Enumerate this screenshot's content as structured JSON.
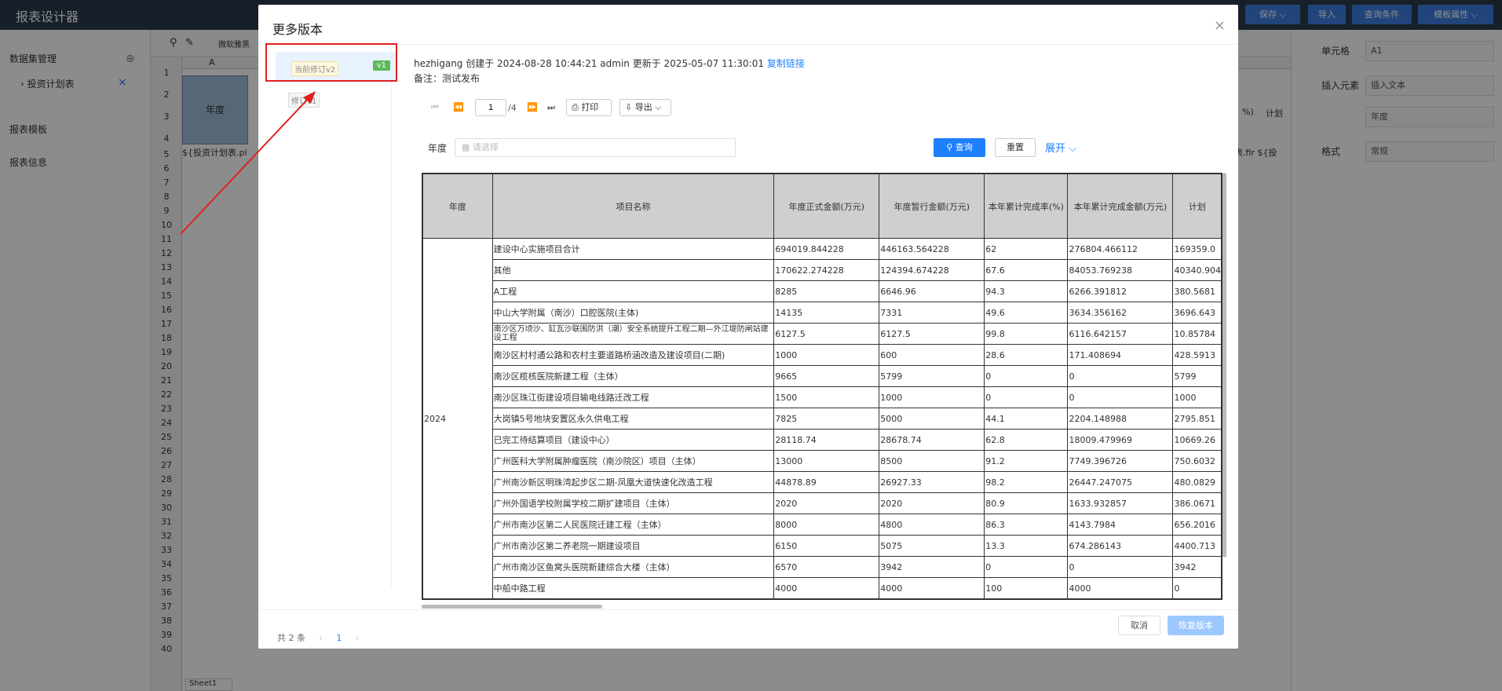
{
  "app": {
    "title": "报表设计器",
    "toolbar_buttons": [
      "保存 ⌵",
      "导入",
      "查询条件",
      "模板属性 ⌵"
    ],
    "left_items": [
      "数据集管理",
      "投资计划表",
      "报表模板",
      "报表信息"
    ],
    "sheet_toolbar_font": "微软雅黑",
    "col_a": "A",
    "cell_year": "年度",
    "cell_formula": "${投资计划表.pl",
    "cell_formula_right": "表.fir ${投",
    "cell_pct": "%)",
    "cell_plan": "计划",
    "row_numbers": [
      "1",
      "2",
      "3",
      "4",
      "5",
      "6",
      "7",
      "8",
      "9",
      "10",
      "11",
      "12",
      "13",
      "14",
      "15",
      "16",
      "17",
      "18",
      "19",
      "20",
      "21",
      "22",
      "23",
      "24",
      "25",
      "26",
      "27",
      "28",
      "29",
      "30",
      "31",
      "32",
      "33",
      "34",
      "35",
      "36",
      "37",
      "38",
      "39",
      "40"
    ],
    "sheet_tab": "Sheet1",
    "right_panel": {
      "cell_label": "单元格",
      "cell_value": "A1",
      "insert_label": "插入元素",
      "insert_value": "插入文本",
      "text_value": "年度",
      "format_label": "格式",
      "format_value": "常规"
    }
  },
  "dialog": {
    "title": "更多版本",
    "close": "×",
    "versions": [
      {
        "label": "当前修订v2",
        "badge": "v1"
      },
      {
        "label": "修订v1"
      }
    ],
    "pager": {
      "total": "共 2 条",
      "prev": "‹",
      "page": "1",
      "next": "›"
    },
    "info_line1_text": "hezhigang 创建于 2024-08-28 10:44:21 admin 更新于 2025-05-07 11:30:01",
    "info_link": "复制链接",
    "info_line2": "备注：测试发布",
    "page_input": "1",
    "page_total": "/4",
    "print": "打印",
    "export": "导出",
    "filter_label": "年度",
    "filter_placeholder": "请选择",
    "query_btn": "查询",
    "reset_btn": "重置",
    "expand": "展开",
    "cancel": "取消",
    "restore": "恢复版本"
  },
  "table": {
    "headers": [
      "年度",
      "项目名称",
      "年度正式金额(万元)",
      "年度暂行金额(万元)",
      "本年累计完成率(%)",
      "本年累计完成金额(万元)",
      "计划"
    ],
    "year": "2024",
    "rows": [
      [
        "建设中心实施项目合计",
        "694019.844228",
        "446163.564228",
        "62",
        "276804.466112",
        "169359.0"
      ],
      [
        "其他",
        "170622.274228",
        "124394.674228",
        "67.6",
        "84053.769238",
        "40340.904"
      ],
      [
        "A工程",
        "8285",
        "6646.96",
        "94.3",
        "6266.391812",
        "380.5681"
      ],
      [
        "中山大学附属（南沙）口腔医院(主体)",
        "14135",
        "7331",
        "49.6",
        "3634.356162",
        "3696.643"
      ],
      [
        "南沙区万顷沙、缸瓦沙联围防洪（潮）安全系统提升工程二期—外江堤防闸站建设工程",
        "6127.5",
        "6127.5",
        "99.8",
        "6116.642157",
        "10.85784"
      ],
      [
        "南沙区村村通公路和农村主要道路桥涵改造及建设项目(二期)",
        "1000",
        "600",
        "28.6",
        "171.408694",
        "428.5913"
      ],
      [
        "南沙区榄核医院新建工程（主体）",
        "9665",
        "5799",
        "0",
        "0",
        "5799"
      ],
      [
        "南沙区珠江街建设项目输电线路迁改工程",
        "1500",
        "1000",
        "0",
        "0",
        "1000"
      ],
      [
        "大岗镇5号地块安置区永久供电工程",
        "7825",
        "5000",
        "44.1",
        "2204.148988",
        "2795.851"
      ],
      [
        "已完工待结算项目（建设中心）",
        "28118.74",
        "28678.74",
        "62.8",
        "18009.479969",
        "10669.26"
      ],
      [
        "广州医科大学附属肿瘤医院（南沙院区）项目（主体）",
        "13000",
        "8500",
        "91.2",
        "7749.396726",
        "750.6032"
      ],
      [
        "广州南沙新区明珠湾起步区二期-凤凰大道快速化改造工程",
        "44878.89",
        "26927.33",
        "98.2",
        "26447.247075",
        "480.0829"
      ],
      [
        "广州外国语学校附属学校二期扩建项目（主体）",
        "2020",
        "2020",
        "80.9",
        "1633.932857",
        "386.0671"
      ],
      [
        "广州市南沙区第二人民医院迁建工程（主体）",
        "8000",
        "4800",
        "86.3",
        "4143.7984",
        "656.2016"
      ],
      [
        "广州市南沙区第二养老院一期建设项目",
        "6150",
        "5075",
        "13.3",
        "674.286143",
        "4400.713"
      ],
      [
        "广州市南沙区鱼窝头医院新建综合大楼（主体）",
        "6570",
        "3942",
        "0",
        "0",
        "3942"
      ],
      [
        "中船中路工程",
        "4000",
        "4000",
        "100",
        "4000",
        "0"
      ]
    ]
  }
}
